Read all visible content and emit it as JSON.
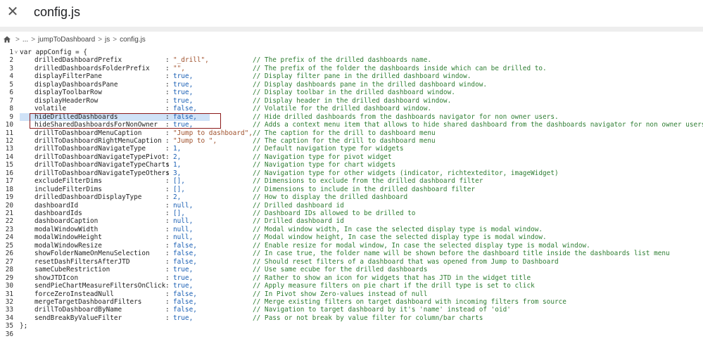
{
  "titlebar": {
    "title": "config.js"
  },
  "breadcrumb": {
    "items": [
      "...",
      "jumpToDashboard",
      "js",
      "config.js"
    ],
    "sep": ">"
  },
  "editor": {
    "lines": [
      {
        "n": "1",
        "fold": "v",
        "code": "var appConfig = {"
      },
      {
        "n": "2",
        "k": "drilledDashboardPrefix",
        "v": "\"_drill\",",
        "t": "str",
        "c": "// The prefix of the drilled dashboards name."
      },
      {
        "n": "3",
        "k": "drilledDashboardsFolderPrefix",
        "v": "\"\",",
        "t": "str",
        "c": "// The prefix of the folder the dashboards inside which can be drilled to."
      },
      {
        "n": "4",
        "k": "displayFilterPane",
        "v": "true,",
        "t": "kw",
        "c": "// Display filter pane in the drilled dashboard window."
      },
      {
        "n": "5",
        "k": "displayDashboardsPane",
        "v": "true,",
        "t": "kw",
        "c": "// Display dashboards pane in the drilled dashboard window."
      },
      {
        "n": "6",
        "k": "displayToolbarRow",
        "v": "true,",
        "t": "kw",
        "c": "// Display toolbar in the drilled dashboard window."
      },
      {
        "n": "7",
        "k": "displayHeaderRow",
        "v": "true,",
        "t": "kw",
        "c": "// Display header in the drilled dashboard window."
      },
      {
        "n": "8",
        "k": "volatile",
        "v": "false,",
        "t": "kw",
        "c": "// Volatile for the drilled dashboard window."
      },
      {
        "n": "9",
        "k": "hideDrilledDashboards",
        "v": "false,",
        "t": "kw",
        "c": "// Hide drilled dashboards from the dashboards navigator for non owner users."
      },
      {
        "n": "10",
        "k": "hideSharedDashboardsForNonOwner",
        "v": "true,",
        "t": "kw",
        "c": "// Adds a context menu item that allows to hide shared dashboard from the dashboards navigator for non owner users."
      },
      {
        "n": "11",
        "k": "drillToDashboardMenuCaption",
        "v": "\"Jump to dashboard\",",
        "t": "str",
        "c": "// The caption for the drill to dashboard menu"
      },
      {
        "n": "12",
        "k": "drillToDashboardRightMenuCaption",
        "v": "\"Jump to \",",
        "t": "str",
        "c": "// The caption for the drill to dashboard menu"
      },
      {
        "n": "13",
        "k": "drillToDashboardNavigateType",
        "v": "1,",
        "t": "num",
        "c": "// Default navigation type for widgets"
      },
      {
        "n": "14",
        "k": "drillToDashboardNavigateTypePivot",
        "v": "2,",
        "t": "num",
        "c": "// Navigation type for pivot widget"
      },
      {
        "n": "15",
        "k": "drillToDashboardNavigateTypeCharts",
        "v": "1,",
        "t": "num",
        "c": "// Navigation type for chart widgets"
      },
      {
        "n": "16",
        "k": "drillToDashboardNavigateTypeOthers",
        "v": "3,",
        "t": "num",
        "c": "// Navigation type for other widgets (indicator, richtexteditor, imageWidget)"
      },
      {
        "n": "17",
        "k": "excludeFilterDims",
        "v": "[],",
        "t": "kw",
        "c": "// Dimensions to exclude from the drilled dashboard filter"
      },
      {
        "n": "18",
        "k": "includeFilterDims",
        "v": "[],",
        "t": "kw",
        "c": "// Dimensions to include in the drilled dashboard filter"
      },
      {
        "n": "19",
        "k": "drilledDashboardDisplayType",
        "v": "2,",
        "t": "num",
        "c": "// How to display the drilled dashboard"
      },
      {
        "n": "20",
        "k": "dashboardId",
        "v": "null,",
        "t": "kw",
        "c": "// Drilled dashboard id"
      },
      {
        "n": "21",
        "k": "dashboardIds",
        "v": "[],",
        "t": "kw",
        "c": "// Dashboard IDs allowed to be drilled to"
      },
      {
        "n": "22",
        "k": "dashboardCaption",
        "v": "null,",
        "t": "kw",
        "c": "// Drilled dashboard id"
      },
      {
        "n": "23",
        "k": "modalWindowWidth",
        "v": "null,",
        "t": "kw",
        "c": "// Modal window width, In case the selected display type is modal window."
      },
      {
        "n": "24",
        "k": "modalWindowHeight",
        "v": "null,",
        "t": "kw",
        "c": "// Modal window height, In case the selected display type is modal window."
      },
      {
        "n": "25",
        "k": "modalWindowResize",
        "v": "false,",
        "t": "kw",
        "c": "// Enable resize for modal window, In case the selected display type is modal window."
      },
      {
        "n": "26",
        "k": "showFolderNameOnMenuSelection",
        "v": "false,",
        "t": "kw",
        "c": "// In case true, the folder name will be shown before the dashboard title inside the dashboards list menu"
      },
      {
        "n": "27",
        "k": "resetDashFiltersAfterJTD",
        "v": "false,",
        "t": "kw",
        "c": "// Should reset filters of a dashboard that was opened from Jump to Dashboard"
      },
      {
        "n": "28",
        "k": "sameCubeRestriction",
        "v": "true,",
        "t": "kw",
        "c": "// Use same ecube for the drilled dashboards"
      },
      {
        "n": "29",
        "k": "showJTDIcon",
        "v": "true,",
        "t": "kw",
        "c": "// Rather to show an icon for widgets that has JTD in the widget title"
      },
      {
        "n": "30",
        "k": "sendPieChartMeasureFiltersOnClick",
        "v": "true,",
        "t": "kw",
        "c": "// Apply measure filters on pie chart if the drill type is set to click"
      },
      {
        "n": "31",
        "k": "forceZeroInsteadNull",
        "v": "false,",
        "t": "kw",
        "c": "// In Pivot show Zero-values instead of null"
      },
      {
        "n": "32",
        "k": "mergeTargetDashboardFilters",
        "v": "false,",
        "t": "kw",
        "c": "// Merge existing filters on target dashboard with incoming filters from source"
      },
      {
        "n": "33",
        "k": "drillToDashboardByName",
        "v": "false,",
        "t": "kw",
        "c": "// Navigation to target dashboard by it's 'name' instead of 'oid'"
      },
      {
        "n": "34",
        "k": "sendBreakByValueFilter",
        "v": "true,",
        "t": "kw",
        "c": "// Pass or not break by value filter for column/bar charts"
      },
      {
        "n": "35",
        "code": "};"
      },
      {
        "n": "36",
        "code": ""
      }
    ]
  }
}
